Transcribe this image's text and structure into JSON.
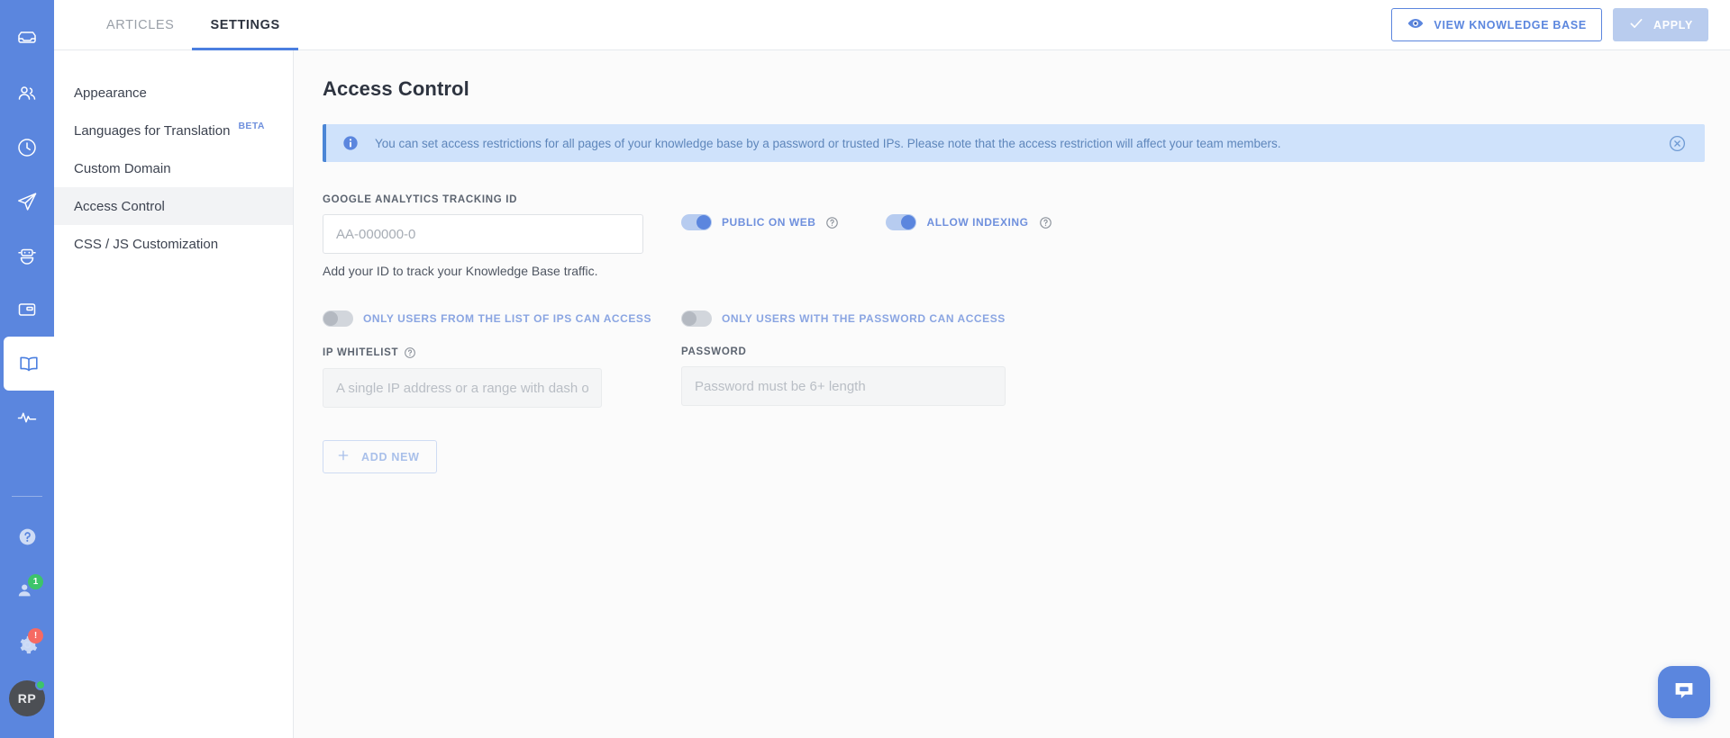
{
  "theme": {
    "rail_blue": "#5b86de",
    "accent_blue": "#4b7fe0",
    "link_blue": "#6f90dd",
    "banner_bg": "#cfe2fb",
    "banner_border": "#4b86d6",
    "badge_green": "#3dc46a",
    "badge_red": "#f66a63"
  },
  "rail": {
    "items": [
      {
        "icon": "inbox-icon",
        "active": false
      },
      {
        "icon": "contacts-icon",
        "active": false
      },
      {
        "icon": "clock-icon",
        "active": false
      },
      {
        "icon": "send-icon",
        "active": false
      },
      {
        "icon": "bot-icon",
        "active": false
      },
      {
        "icon": "broadcast-icon",
        "active": false
      },
      {
        "icon": "knowledge-base-icon",
        "active": true
      },
      {
        "icon": "activity-icon",
        "active": false
      }
    ],
    "bottom": {
      "help_icon": "help-icon",
      "invite_icon": "invite-user-icon",
      "invite_badge": "1",
      "settings_icon": "gear-icon",
      "settings_badge": "!",
      "avatar_initials": "RP"
    }
  },
  "topbar": {
    "tabs": [
      {
        "label": "ARTICLES",
        "active": false
      },
      {
        "label": "SETTINGS",
        "active": true
      }
    ],
    "view_kb_label": "VIEW KNOWLEDGE BASE",
    "view_kb_icon": "eye-icon",
    "apply_label": "APPLY",
    "apply_icon": "check-icon",
    "apply_disabled": true
  },
  "settings_nav": {
    "items": [
      {
        "label": "Appearance",
        "badge": "",
        "active": false
      },
      {
        "label": "Languages for Translation",
        "badge": "BETA",
        "active": false
      },
      {
        "label": "Custom Domain",
        "badge": "",
        "active": false
      },
      {
        "label": "Access Control",
        "badge": "",
        "active": true
      },
      {
        "label": "CSS / JS Customization",
        "badge": "",
        "active": false
      }
    ]
  },
  "main": {
    "title": "Access Control",
    "banner": {
      "icon": "info-icon",
      "text": "You can set access restrictions for all pages of your knowledge base by a password or trusted IPs. Please note that the access restriction will affect your team members.",
      "close_icon": "close-circle-icon"
    },
    "ga": {
      "label": "GOOGLE ANALYTICS TRACKING ID",
      "value": "",
      "placeholder": "AA-000000-0",
      "hint": "Add your ID to track your Knowledge Base traffic."
    },
    "toggles": {
      "public_on_web": {
        "label": "PUBLIC ON WEB",
        "on": true,
        "help": "help-circle-icon"
      },
      "allow_indexing": {
        "label": "ALLOW INDEXING",
        "on": true,
        "help": "help-circle-icon"
      },
      "only_ips": {
        "label": "ONLY USERS FROM THE LIST OF IPS CAN ACCESS",
        "on": false
      },
      "only_password": {
        "label": "ONLY USERS WITH THE PASSWORD CAN ACCESS",
        "on": false
      }
    },
    "ip_whitelist": {
      "label": "IP WHITELIST",
      "help": "help-circle-icon",
      "value": "",
      "placeholder": "A single IP address or a range with dash or",
      "disabled": true
    },
    "password": {
      "label": "PASSWORD",
      "value": "",
      "placeholder": "Password must be 6+ length",
      "disabled": true
    },
    "add_new": {
      "label": "ADD NEW",
      "icon": "plus-icon"
    }
  },
  "chat_widget": {
    "icon": "chat-bubble-icon"
  }
}
